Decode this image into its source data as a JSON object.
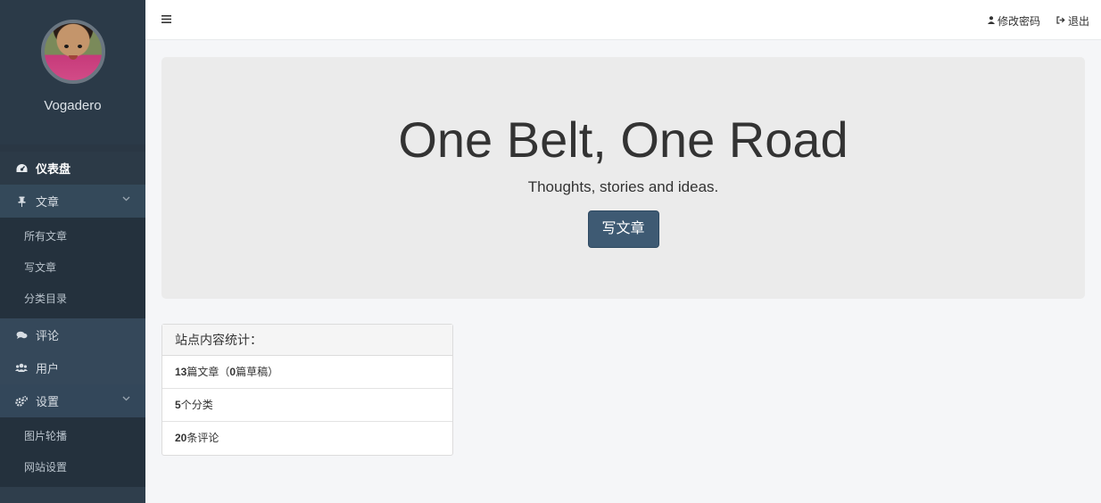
{
  "profile": {
    "username": "Vogadero"
  },
  "sidebar": {
    "items": [
      {
        "label": "仪表盘",
        "icon": "dashboard-icon"
      },
      {
        "label": "文章",
        "icon": "pushpin-icon",
        "submenu": [
          "所有文章",
          "写文章",
          "分类目录"
        ]
      },
      {
        "label": "评论",
        "icon": "comments-icon"
      },
      {
        "label": "用户",
        "icon": "users-icon"
      },
      {
        "label": "设置",
        "icon": "cogs-icon",
        "submenu": [
          "图片轮播",
          "网站设置"
        ]
      }
    ]
  },
  "topbar": {
    "menu_icon": "hamburger-icon",
    "change_password": "修改密码",
    "logout": "退出"
  },
  "jumbotron": {
    "title": "One Belt, One Road",
    "subtitle": "Thoughts, stories and ideas.",
    "button": "写文章"
  },
  "stats": {
    "heading": "站点内容统计：",
    "articles_count": "13",
    "articles_text": "篇文章（",
    "drafts_count": "0",
    "drafts_text": "篇草稿）",
    "categories_count": "5",
    "categories_text": "个分类",
    "comments_count": "20",
    "comments_text": "条评论"
  },
  "colors": {
    "sidebar_bg": "#2f3e4c",
    "button_bg": "#3e5a73"
  }
}
